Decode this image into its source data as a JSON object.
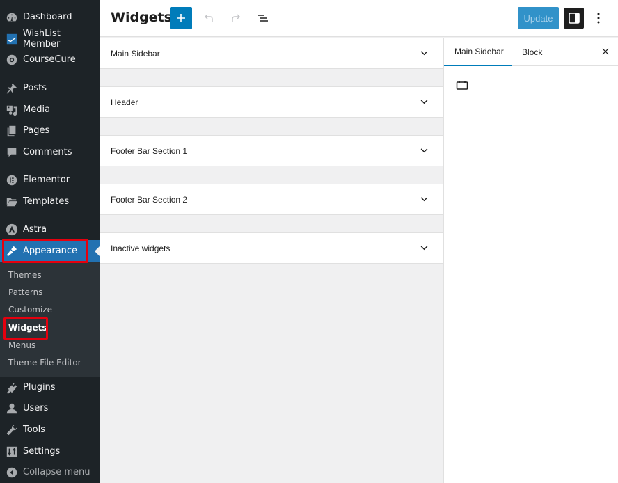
{
  "sidebar": {
    "items": [
      {
        "label": "Dashboard",
        "icon": "dashboard-icon"
      },
      {
        "label": "WishList Member",
        "icon": "wishlist-icon"
      },
      {
        "label": "CourseCure",
        "icon": "coursecure-icon"
      },
      {
        "label": "Posts",
        "icon": "pin-icon"
      },
      {
        "label": "Media",
        "icon": "media-icon"
      },
      {
        "label": "Pages",
        "icon": "pages-icon"
      },
      {
        "label": "Comments",
        "icon": "comment-icon"
      },
      {
        "label": "Elementor",
        "icon": "elementor-icon"
      },
      {
        "label": "Templates",
        "icon": "folder-icon"
      },
      {
        "label": "Astra",
        "icon": "astra-icon"
      },
      {
        "label": "Appearance",
        "icon": "paintbrush-icon"
      },
      {
        "label": "Plugins",
        "icon": "plug-icon"
      },
      {
        "label": "Users",
        "icon": "user-icon"
      },
      {
        "label": "Tools",
        "icon": "wrench-icon"
      },
      {
        "label": "Settings",
        "icon": "settings-icon"
      }
    ],
    "submenu": [
      "Themes",
      "Patterns",
      "Customize",
      "Widgets",
      "Menus",
      "Theme File Editor"
    ],
    "collapse_label": "Collapse menu",
    "current_item": "Appearance",
    "current_subitem": "Widgets"
  },
  "header": {
    "title": "Widgets",
    "add_label": "+",
    "update_label": "Update"
  },
  "widget_areas": [
    {
      "title": "Main Sidebar"
    },
    {
      "title": "Header"
    },
    {
      "title": "Footer Bar Section 1"
    },
    {
      "title": "Footer Bar Section 2"
    },
    {
      "title": "Inactive widgets"
    }
  ],
  "inspector": {
    "tabs": [
      {
        "label": "Main Sidebar",
        "active": true
      },
      {
        "label": "Block",
        "active": false
      }
    ]
  },
  "colors": {
    "accent": "#007cba",
    "admin_bg": "#1d2327",
    "current_menu": "#2271b1",
    "highlight": "#e5000e"
  }
}
